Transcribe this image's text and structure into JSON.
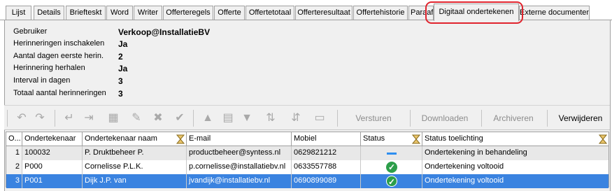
{
  "tabs": [
    {
      "label": "Lijst"
    },
    {
      "label": "Details"
    },
    {
      "label": "Briefteskt"
    },
    {
      "label": "Word"
    },
    {
      "label": "Writer"
    },
    {
      "label": "Offerteregels"
    },
    {
      "label": "Offerte"
    },
    {
      "label": "Offertetotaal"
    },
    {
      "label": "Offerteresultaat"
    },
    {
      "label": "Offertehistorie"
    },
    {
      "label": "Paraaf"
    },
    {
      "label": "Digitaal ondertekenen"
    },
    {
      "label": "Externe documenten"
    }
  ],
  "active_tab": "Digitaal ondertekenen",
  "properties": [
    {
      "label": "Gebruiker",
      "value": "Verkoop@InstallatieBV"
    },
    {
      "label": "Herinneringen inschakelen",
      "value": "Ja"
    },
    {
      "label": "Aantal dagen eerste herin.",
      "value": "2"
    },
    {
      "label": "Herinnering herhalen",
      "value": "Ja"
    },
    {
      "label": "Interval in dagen",
      "value": "3"
    },
    {
      "label": "Totaal aantal herinneringen",
      "value": "3"
    }
  ],
  "toolbar": {
    "versturen": "Versturen",
    "downloaden": "Downloaden",
    "archiveren": "Archiveren",
    "verwijderen": "Verwijderen"
  },
  "grid": {
    "columns": [
      "O...",
      "Ondertekenaar",
      "Ondertekenaar naam",
      "E-mail",
      "Mobiel",
      "Status",
      "Status toelichting"
    ],
    "rows": [
      {
        "num": "1",
        "ondertekenaar": "100032",
        "naam": "P. Druktbeheer P.",
        "email": "productbeheer@syntess.nl",
        "mobiel": "0629821212",
        "status": "in-behandeling",
        "toelichting": "Ondertekening in behandeling"
      },
      {
        "num": "2",
        "ondertekenaar": "P000",
        "naam": "Cornelisse P.L.K.",
        "email": "p.cornelisse@installatiebv.nl",
        "mobiel": "0633557788",
        "status": "voltooid",
        "toelichting": "Ondertekening voltooid"
      },
      {
        "num": "3",
        "ondertekenaar": "P001",
        "naam": "Dijk J.P.  van",
        "email": "jvandijk@installatiebv.nl",
        "mobiel": "0690899089",
        "status": "voltooid",
        "toelichting": "Ondertekening voltooid"
      }
    ]
  },
  "colors": {
    "highlight_ring": "#e0242e",
    "selected_row": "#3a83e0",
    "status_ok": "#2c9e4a",
    "status_pending": "#2d8ef0"
  }
}
